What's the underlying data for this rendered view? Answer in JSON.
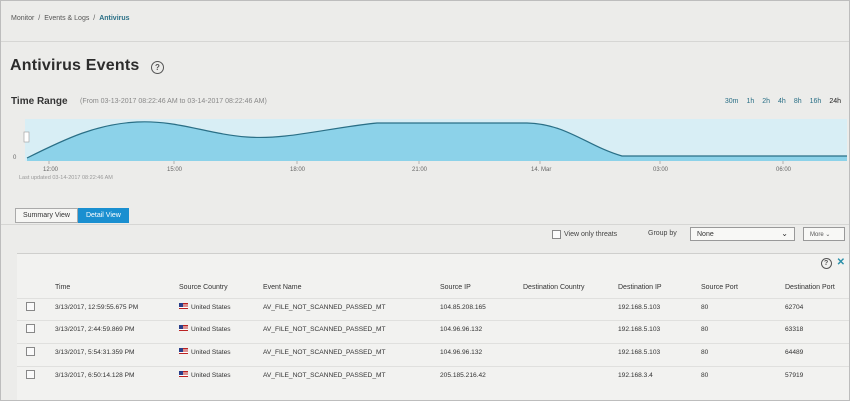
{
  "breadcrumb": {
    "items": [
      "Monitor",
      "Events & Logs",
      "Antivirus"
    ],
    "separator": "/"
  },
  "page": {
    "title": "Antivirus Events",
    "help_icon": "question-circle-icon"
  },
  "time_range": {
    "label": "Time Range",
    "range_text": "(From 03-13-2017 08:22:46 AM to 03-14-2017 08:22:46 AM)",
    "buttons": [
      "30m",
      "1h",
      "2h",
      "4h",
      "8h",
      "16h",
      "24h"
    ],
    "active_button": "24h"
  },
  "chart_data": {
    "type": "area",
    "x_ticks": [
      "12:00",
      "15:00",
      "18:00",
      "21:00",
      "14. Mar",
      "03:00",
      "06:00"
    ],
    "y_ticks": [
      "0"
    ],
    "fill_color": "#7fcde6",
    "line_color": "#2a6f86",
    "last_updated": "Last updated 03-14-2017 08:22:46 AM"
  },
  "view_toggle": {
    "summary_label": "Summary View",
    "detail_label": "Detail View",
    "active": "detail"
  },
  "filters": {
    "threats_label": "View only threats",
    "group_by_label": "Group by",
    "group_by_value": "None",
    "more_label": "More"
  },
  "grid_tools": {
    "help_icon": "question-circle-icon",
    "close_icon": "close-icon"
  },
  "table": {
    "columns": [
      "Time",
      "Source Country",
      "Event Name",
      "Source IP",
      "Destination Country",
      "Destination IP",
      "Source Port",
      "Destination Port"
    ],
    "rows": [
      {
        "time": "3/13/2017, 12:59:55.675 PM",
        "source_country": "United States",
        "event": "AV_FILE_NOT_SCANNED_PASSED_MT",
        "source_ip": "104.85.208.165",
        "dest_country": "",
        "dest_ip": "192.168.5.103",
        "source_port": "80",
        "dest_port": "62704"
      },
      {
        "time": "3/13/2017, 2:44:59.869 PM",
        "source_country": "United States",
        "event": "AV_FILE_NOT_SCANNED_PASSED_MT",
        "source_ip": "104.96.96.132",
        "dest_country": "",
        "dest_ip": "192.168.5.103",
        "source_port": "80",
        "dest_port": "63318"
      },
      {
        "time": "3/13/2017, 5:54:31.359 PM",
        "source_country": "United States",
        "event": "AV_FILE_NOT_SCANNED_PASSED_MT",
        "source_ip": "104.96.96.132",
        "dest_country": "",
        "dest_ip": "192.168.5.103",
        "source_port": "80",
        "dest_port": "64489"
      },
      {
        "time": "3/13/2017, 6:50:14.128 PM",
        "source_country": "United States",
        "event": "AV_FILE_NOT_SCANNED_PASSED_MT",
        "source_ip": "205.185.216.42",
        "dest_country": "",
        "dest_ip": "192.168.3.4",
        "source_port": "80",
        "dest_port": "57919"
      }
    ]
  },
  "colors": {
    "accent": "#1a8fd0",
    "link": "#2a6f86",
    "chart_fill": "#7fcde6"
  }
}
